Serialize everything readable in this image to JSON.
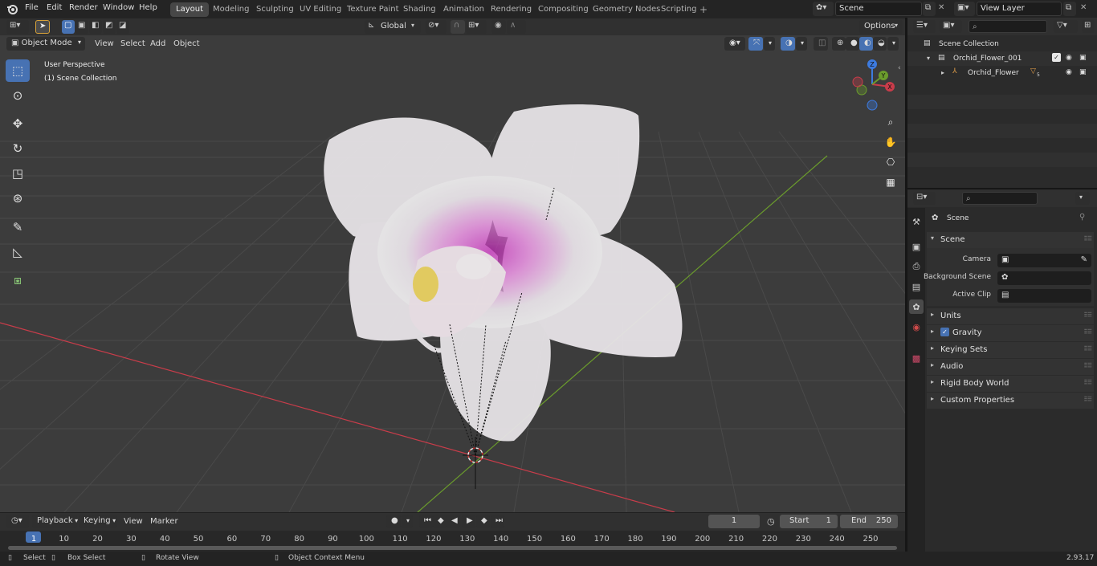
{
  "menu": [
    "File",
    "Edit",
    "Render",
    "Window",
    "Help"
  ],
  "workspaces": [
    "Layout",
    "Modeling",
    "Sculpting",
    "UV Editing",
    "Texture Paint",
    "Shading",
    "Animation",
    "Rendering",
    "Compositing",
    "Geometry Nodes",
    "Scripting"
  ],
  "active_workspace": "Layout",
  "scene_name": "Scene",
  "view_layer": "View Layer",
  "viewport": {
    "mode": "Object Mode",
    "menus": [
      "View",
      "Select",
      "Add",
      "Object"
    ],
    "transform_orientation": "Global",
    "options_label": "Options",
    "overlay_title": "User Perspective",
    "overlay_subtitle": "(1) Scene Collection",
    "gizmo_axes": [
      "X",
      "Y",
      "Z"
    ]
  },
  "outliner": {
    "root": "Scene Collection",
    "collection": "Orchid_Flower_001",
    "object": "Orchid_Flower",
    "object_badge": "5"
  },
  "properties": {
    "context": "Scene",
    "panel": "Scene",
    "fields": [
      {
        "label": "Camera"
      },
      {
        "label": "Background Scene"
      },
      {
        "label": "Active Clip"
      }
    ],
    "subpanels": [
      "Units",
      "Gravity",
      "Keying Sets",
      "Audio",
      "Rigid Body World",
      "Custom Properties"
    ],
    "gravity_checked": true
  },
  "timeline": {
    "menus": [
      "Playback",
      "Keying",
      "View",
      "Marker"
    ],
    "current_frame": "1",
    "start_label": "Start",
    "start_value": "1",
    "end_label": "End",
    "end_value": "250",
    "ticks": [
      "1",
      "10",
      "20",
      "30",
      "40",
      "50",
      "60",
      "70",
      "80",
      "90",
      "100",
      "110",
      "120",
      "130",
      "140",
      "150",
      "160",
      "170",
      "180",
      "190",
      "200",
      "210",
      "220",
      "230",
      "240",
      "250"
    ]
  },
  "statusbar": {
    "select": "Select",
    "box_select": "Box Select",
    "rotate_view": "Rotate View",
    "context_menu": "Object Context Menu",
    "version": "2.93.17"
  },
  "colors": {
    "accent": "#4772b3",
    "x_axis": "#c93c4a",
    "y_axis": "#6b9c2c",
    "z_axis": "#3d7be0",
    "petal_pink": "#cf2bc2"
  }
}
